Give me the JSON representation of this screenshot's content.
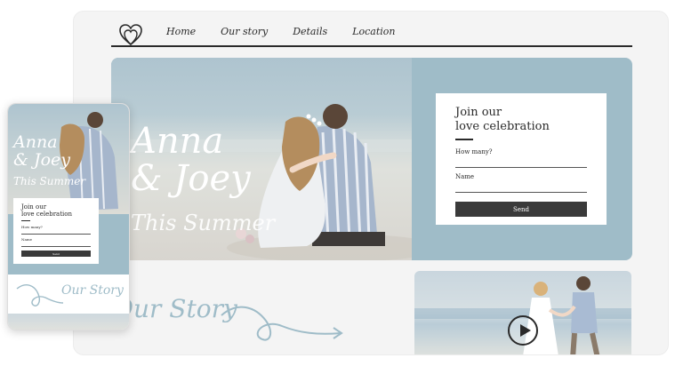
{
  "nav": {
    "logo_icon": "double-heart-icon",
    "links": [
      "Home",
      "Our story",
      "Details",
      "Location"
    ]
  },
  "hero": {
    "line1": "Anna",
    "line2": "& Joey",
    "line3": "This Summer"
  },
  "rsvp": {
    "heading_line1": "Join our",
    "heading_line2": "love celebration",
    "field_count_label": "How many?",
    "field_name_label": "Name",
    "send_label": "Send"
  },
  "story": {
    "title": "Our Story",
    "video_icon": "play-icon"
  },
  "colors": {
    "accent": "#9fbcc8",
    "dark": "#2a2a2a",
    "button": "#3a3a3a",
    "page_bg": "#f4f4f4"
  }
}
